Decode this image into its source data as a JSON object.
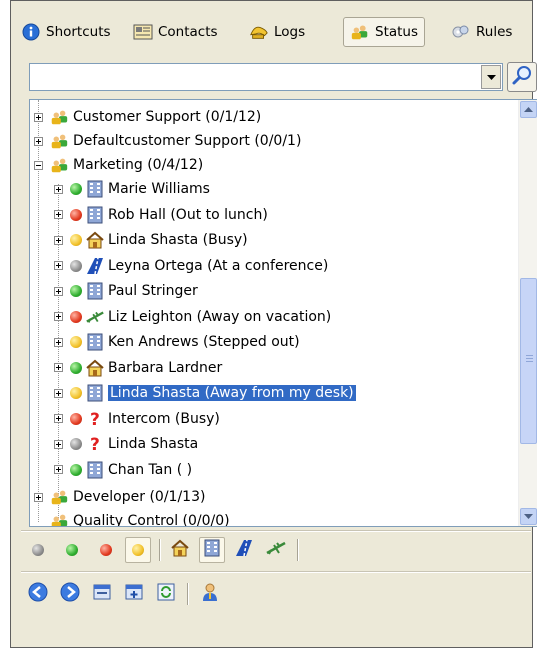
{
  "tabs": [
    {
      "label": "Shortcuts",
      "icon": "info-icon"
    },
    {
      "label": "Contacts",
      "icon": "address-book-icon"
    },
    {
      "label": "Logs",
      "icon": "phone-log-icon"
    },
    {
      "label": "Status",
      "icon": "people-status-icon",
      "active": true
    },
    {
      "label": "Rules",
      "icon": "rules-icon"
    }
  ],
  "search": {
    "value": "",
    "placeholder": ""
  },
  "tree": {
    "groups": {
      "customer_support": "Customer Support   (0/1/12)",
      "defaultcustomer_support": "Defaultcustomer Support   (0/0/1)",
      "marketing": "Marketing   (0/4/12)",
      "developer": "Developer   (0/1/13)",
      "quality_control": "Quality Control   (0/0/0)"
    },
    "contacts": [
      {
        "name": "Marie Williams",
        "status": "green",
        "location": "office"
      },
      {
        "name": "Rob Hall (Out to lunch)",
        "status": "red",
        "location": "office"
      },
      {
        "name": "Linda Shasta (Busy)",
        "status": "yellow",
        "location": "home"
      },
      {
        "name": "Leyna Ortega (At a conference)",
        "status": "gray",
        "location": "road"
      },
      {
        "name": "Paul Stringer",
        "status": "green",
        "location": "office"
      },
      {
        "name": "Liz Leighton (Away on vacation)",
        "status": "red",
        "location": "vacation"
      },
      {
        "name": "Ken Andrews (Stepped out)",
        "status": "yellow",
        "location": "office"
      },
      {
        "name": "Barbara Lardner",
        "status": "green",
        "location": "home"
      },
      {
        "name": "Linda Shasta (Away from my desk)",
        "status": "yellow",
        "location": "office",
        "selected": true
      },
      {
        "name": "Intercom (Busy)",
        "status": "red",
        "location": "unknown"
      },
      {
        "name": "Linda Shasta",
        "status": "gray",
        "location": "unknown"
      },
      {
        "name": "Chan Tan ( )",
        "status": "green",
        "location": "office"
      }
    ]
  },
  "status_toolbar": {
    "buttons": [
      "status-gray",
      "status-green",
      "status-red",
      "status-yellow",
      "location-home",
      "location-office",
      "location-road",
      "location-vacation"
    ],
    "pressed": [
      "status-yellow",
      "location-office"
    ]
  },
  "action_toolbar": {
    "buttons": [
      "back",
      "forward",
      "window",
      "add-panel",
      "refresh",
      "user"
    ]
  },
  "colors": {
    "selection": "#316ac5",
    "chrome": "#ece9d8",
    "border": "#7f9db9"
  }
}
